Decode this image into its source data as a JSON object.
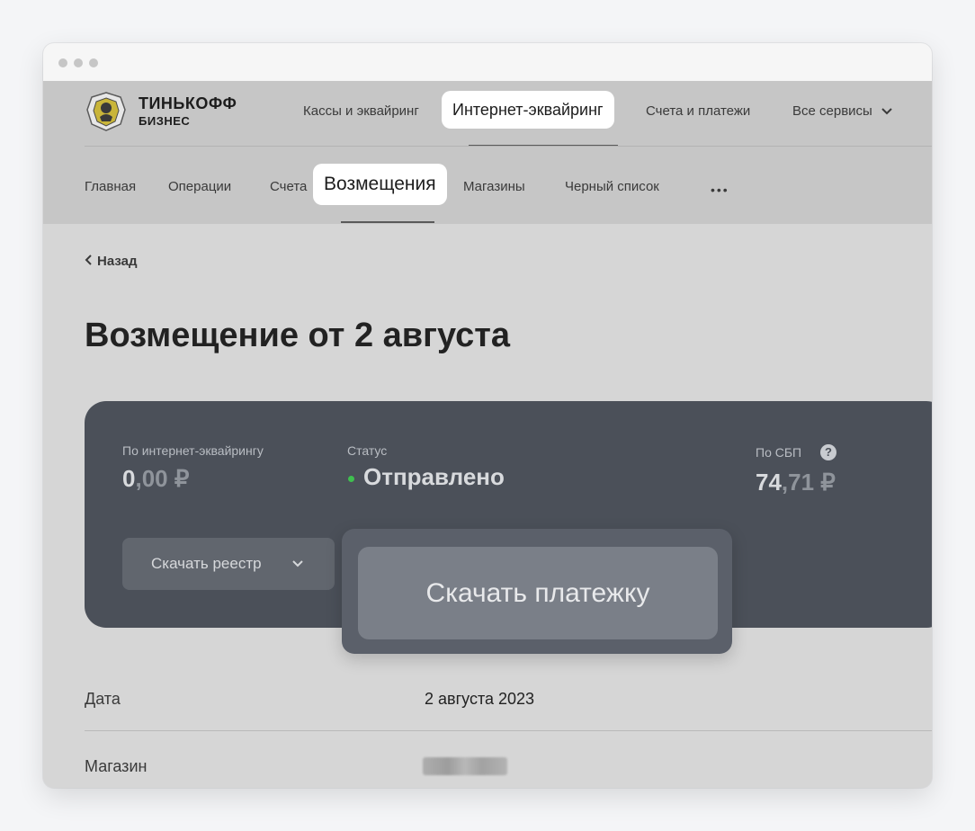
{
  "brand": {
    "line1": "ТИНЬКОФФ",
    "line2": "БИЗНЕС"
  },
  "top_nav": {
    "items": [
      {
        "label": "Кассы и эквайринг"
      },
      {
        "label": "Интернет-эквайринг",
        "active": true
      },
      {
        "label": "Счета и платежи"
      },
      {
        "label": "Все сервисы"
      }
    ]
  },
  "sub_nav": {
    "items": [
      {
        "label": "Главная"
      },
      {
        "label": "Операции"
      },
      {
        "label": "Счета"
      },
      {
        "label": "Возмещения",
        "active": true
      },
      {
        "label": "Магазины"
      },
      {
        "label": "Черный список"
      }
    ],
    "more": "•••"
  },
  "back": {
    "label": "Назад"
  },
  "page_title": "Возмещение от 2 августа",
  "summary": {
    "internet_acquiring": {
      "label": "По интернет-эквайрингу",
      "whole": "0",
      "fraction": ",00 ₽"
    },
    "status": {
      "label": "Статус",
      "value": "Отправлено",
      "color": "#3fbf4f"
    },
    "sbp": {
      "label": "По СБП",
      "whole": "74",
      "fraction": ",71 ₽",
      "help_icon": "?"
    },
    "download_registry": "Скачать реестр",
    "download_payment": "Скачать платежку"
  },
  "details": [
    {
      "label": "Дата",
      "value": "2 августа 2023"
    },
    {
      "label": "Магазин",
      "value": ""
    }
  ],
  "colors": {
    "card_bg": "#4b5059",
    "overlay_bg": "#c6c6c6",
    "status_green": "#3fbf4f"
  }
}
